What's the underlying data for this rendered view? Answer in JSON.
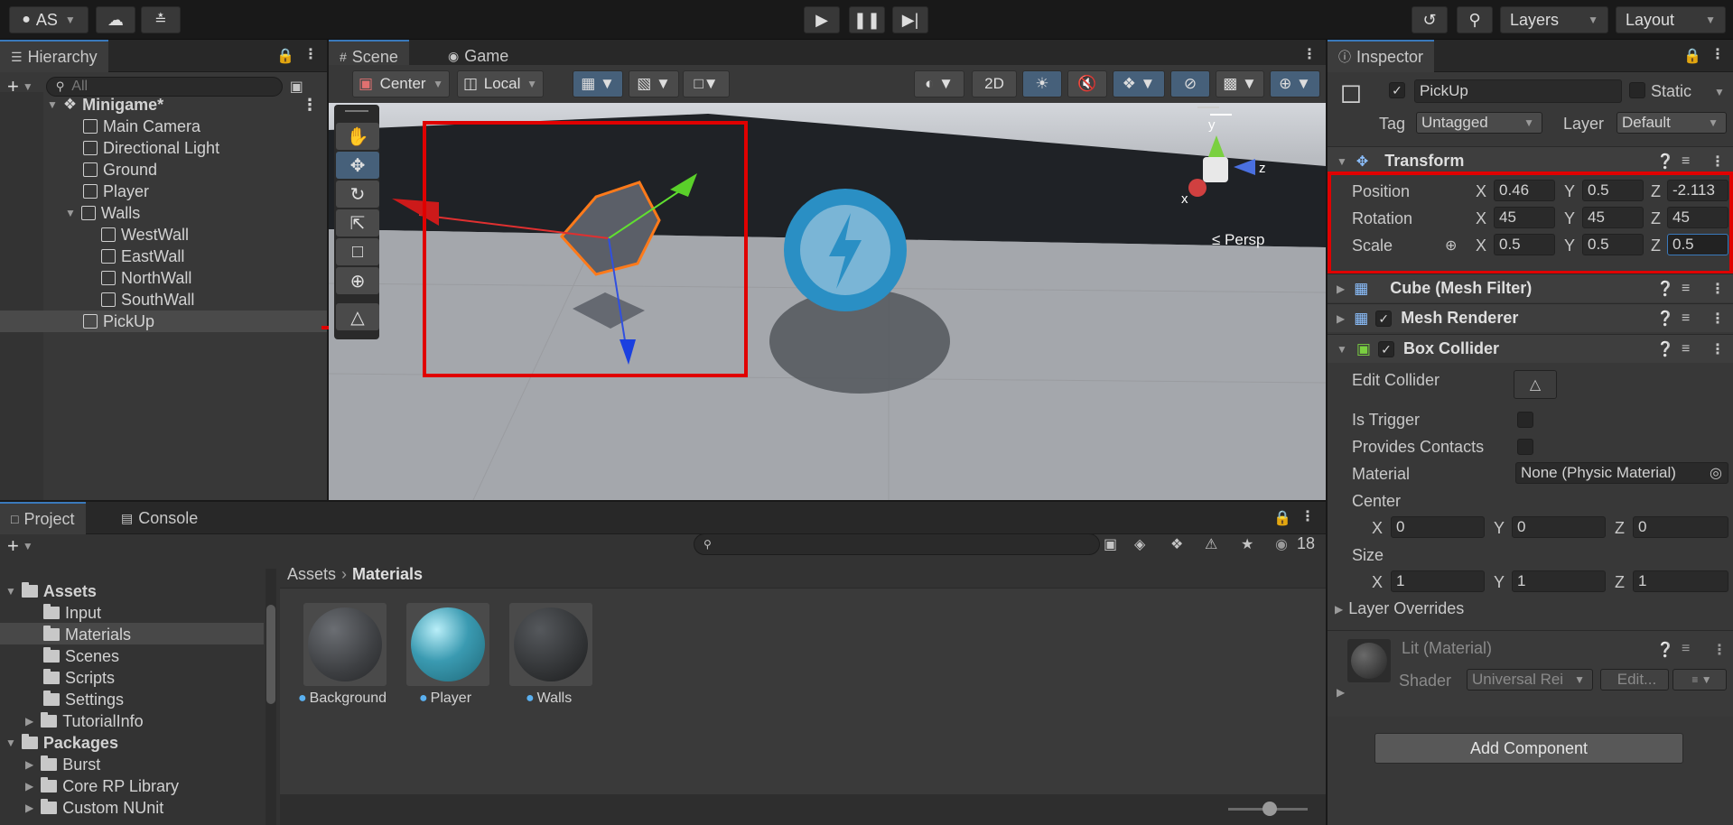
{
  "topbar": {
    "account": "AS",
    "layers_label": "Layers",
    "layout_label": "Layout"
  },
  "hierarchy": {
    "tab_label": "Hierarchy",
    "search_placeholder": "All",
    "scene_name": "Minigame*",
    "items": [
      {
        "label": "Main Camera"
      },
      {
        "label": "Directional Light"
      },
      {
        "label": "Ground"
      },
      {
        "label": "Player"
      },
      {
        "label": "Walls"
      },
      {
        "label": "WestWall"
      },
      {
        "label": "EastWall"
      },
      {
        "label": "NorthWall"
      },
      {
        "label": "SouthWall"
      },
      {
        "label": "PickUp"
      }
    ]
  },
  "scene": {
    "tab_scene": "Scene",
    "tab_game": "Game",
    "pivot_label": "Center",
    "space_label": "Local",
    "btn_2d": "2D",
    "persp_label": "≤ Persp",
    "gizmo_y": "y",
    "gizmo_x": "x",
    "gizmo_z": "z"
  },
  "inspector": {
    "tab_label": "Inspector",
    "object_name": "PickUp",
    "static_label": "Static",
    "tag_label": "Tag",
    "tag_value": "Untagged",
    "layer_label": "Layer",
    "layer_value": "Default",
    "transform": {
      "title": "Transform",
      "position_label": "Position",
      "rotation_label": "Rotation",
      "scale_label": "Scale",
      "x": "X",
      "y": "Y",
      "z": "Z",
      "position": {
        "x": "0.46",
        "y": "0.5",
        "z": "-2.113"
      },
      "rotation": {
        "x": "45",
        "y": "45",
        "z": "45"
      },
      "scale": {
        "x": "0.5",
        "y": "0.5",
        "z": "0.5"
      }
    },
    "mesh_filter_title": "Cube (Mesh Filter)",
    "mesh_renderer_title": "Mesh Renderer",
    "box_collider": {
      "title": "Box Collider",
      "edit_collider": "Edit Collider",
      "is_trigger": "Is Trigger",
      "provides_contacts": "Provides Contacts",
      "material_label": "Material",
      "material_value": "None (Physic Material)",
      "center_label": "Center",
      "center": {
        "x": "0",
        "y": "0",
        "z": "0"
      },
      "size_label": "Size",
      "size": {
        "x": "1",
        "y": "1",
        "z": "1"
      },
      "layer_overrides": "Layer Overrides"
    },
    "material": {
      "title": "Lit (Material)",
      "shader_label": "Shader",
      "shader_value": "Universal Rei",
      "edit_label": "Edit..."
    },
    "add_component": "Add Component"
  },
  "project": {
    "tab_project": "Project",
    "tab_console": "Console",
    "count": "18",
    "breadcrumb_root": "Assets",
    "breadcrumb_current": "Materials",
    "tree": [
      {
        "label": "Assets",
        "bold": true
      },
      {
        "label": "Input"
      },
      {
        "label": "Materials"
      },
      {
        "label": "Scenes"
      },
      {
        "label": "Scripts"
      },
      {
        "label": "Settings"
      },
      {
        "label": "TutorialInfo"
      },
      {
        "label": "Packages",
        "bold": true
      },
      {
        "label": "Burst"
      },
      {
        "label": "Core RP Library"
      },
      {
        "label": "Custom NUnit"
      }
    ],
    "assets": [
      {
        "label": "Background",
        "color": "#3d3f42"
      },
      {
        "label": "Player",
        "color": "#3a9ab1"
      },
      {
        "label": "Walls",
        "color": "#323436"
      }
    ]
  },
  "colors": {
    "highlight_red": "#e00000",
    "accent_blue": "#3a79bb",
    "player_sphere": "#2a8fc4"
  }
}
